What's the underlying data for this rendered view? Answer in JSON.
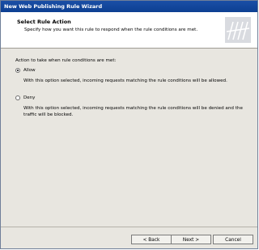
{
  "window": {
    "title": "New Web Publishing Rule Wizard"
  },
  "header": {
    "title": "Select Rule Action",
    "subtitle": "Specify how you want this rule to respond when the rule conditions are met."
  },
  "content": {
    "section_label": "Action to take when rule conditions are met:",
    "options": [
      {
        "label": "Allow",
        "checked": true,
        "description": "With this option selected, incoming requests matching the rule conditions will be allowed."
      },
      {
        "label": "Deny",
        "checked": false,
        "description": "With this option selected, incoming requests matching the rule conditions will be denied and the traffic will be blocked."
      }
    ]
  },
  "buttons": {
    "back": "< Back",
    "next": "Next >",
    "cancel": "Cancel"
  }
}
